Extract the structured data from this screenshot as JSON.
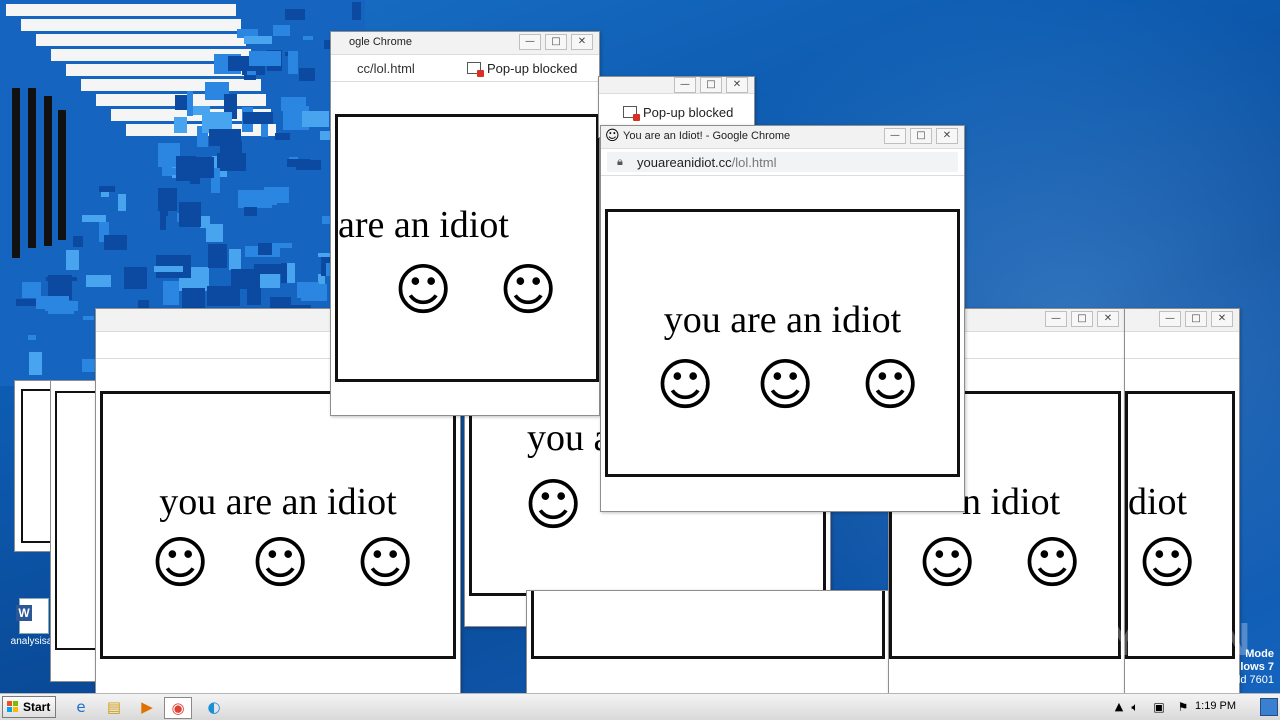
{
  "window_title": "You are an Idiot! - Google Chrome",
  "window_title_cut": "ogle Chrome",
  "url_domain": "youareanidiot.cc",
  "url_path": "/lol.html",
  "url_cut": "cc/lol.html",
  "popup_blocked": "Pop-up blocked",
  "message": "you are an idiot",
  "message_cut_a": "are an idiot",
  "message_cut_b": "you a",
  "message_cut_c": "n idiot",
  "message_cut_d": "diot",
  "smiley": "☺",
  "win_buttons": {
    "min": "—",
    "max": "□",
    "close": "✕"
  },
  "taskbar": {
    "start_label": "Start",
    "clock": "1:19 PM",
    "icons": [
      "ie-icon",
      "explorer-icon",
      "media-player-icon",
      "chrome-icon",
      "edge-icon"
    ]
  },
  "desktop_icon_label": "analysisac",
  "watermark": {
    "brand": "ANY.RUN",
    "test_mode_lines": [
      "Mode",
      "lows 7",
      "ld 7601"
    ]
  }
}
